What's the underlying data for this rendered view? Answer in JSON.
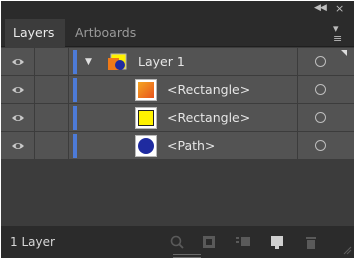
{
  "panel": {
    "collapse_icon": "double-chevron-left-icon",
    "close_glyph": "×",
    "tabs": [
      {
        "label": "Layers",
        "active": true
      },
      {
        "label": "Artboards",
        "active": false
      }
    ],
    "menu_icon": "panel-menu-icon"
  },
  "rows": [
    {
      "label": "Layer 1",
      "type": "layer",
      "expanded": true,
      "thumb_icon": "layer-thumbnail-icon"
    },
    {
      "label": "<Rectangle>",
      "type": "item",
      "thumb_icon": "rectangle-thumbnail-icon",
      "fill": "#f07a18"
    },
    {
      "label": "<Rectangle>",
      "type": "item",
      "thumb_icon": "rectangle-thumbnail-icon",
      "fill": "#fff200"
    },
    {
      "label": "<Path>",
      "type": "item",
      "thumb_icon": "path-thumbnail-icon",
      "fill": "#1f2ba0"
    }
  ],
  "colors": {
    "layer_color": "#4d7bd8",
    "panel_bg": "#535353",
    "chrome_bg": "#2b2b2b"
  },
  "footer": {
    "count_text": "1 Layer",
    "icons": [
      "locate-object-icon",
      "make-clipping-mask-icon",
      "create-sublayer-icon",
      "create-new-layer-icon",
      "delete-icon"
    ]
  }
}
